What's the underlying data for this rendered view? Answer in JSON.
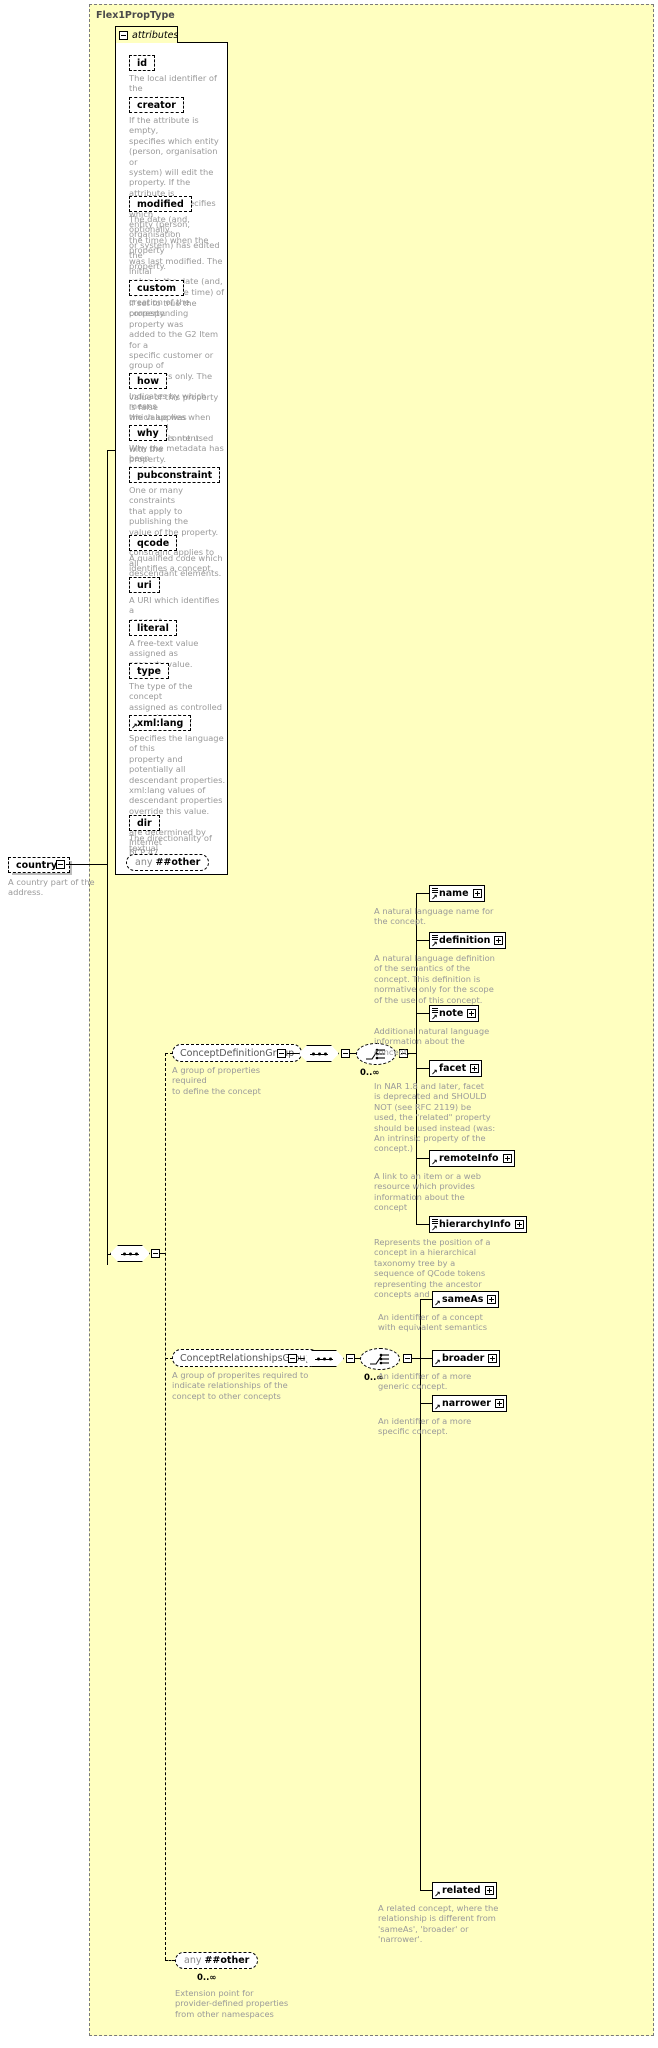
{
  "diagram": {
    "type_name": "Flex1PropType",
    "attributes_tab_label": "attributes",
    "attributes": [
      {
        "name": "id",
        "desc": "The local identifier of the\nproperty."
      },
      {
        "name": "creator",
        "desc": "If the attribute is empty,\nspecifies which entity\n(person, organisation or\nsystem) will edit the\nproperty. If the attribute is\nnon-empty, specifies which\nentity (person, organisation\nor system) has edited the\nproperty."
      },
      {
        "name": "modified",
        "desc": "The date (and, optionally,\nthe time) when the property\nwas last modified. The initial\nvalue is the date (and,\noptionally, the time) of\ncreation of the property."
      },
      {
        "name": "custom",
        "desc": "If set to true the\ncorresponding property was\nadded to the G2 Item for a\nspecific customer or group of\ncustomers only. The default\nvalue of this property is false\nwhich applies when this\nattribute is not used with the\nproperty."
      },
      {
        "name": "how",
        "desc": "Indicates by which means\nthe value was extracted\nfrom the content."
      },
      {
        "name": "why",
        "desc": "Why the metadata has been\nincluded."
      },
      {
        "name": "pubconstraint",
        "desc": "One or many constraints\nthat apply to publishing the\nvalue of the property. Each\nconstraint applies to all\ndescendant elements."
      },
      {
        "name": "qcode",
        "desc": "A qualified code which\nidentifies a concept."
      },
      {
        "name": "uri",
        "desc": "A URI which identifies a\nconcept."
      },
      {
        "name": "literal",
        "desc": "A free-text value assigned as\nproperty value."
      },
      {
        "name": "type",
        "desc": "The type of the concept\nassigned as controlled\nproperty value."
      },
      {
        "name": "xml:lang",
        "desc": "Specifies the language of this\nproperty and potentially all\ndescendant properties.\nxml:lang values of\ndescendant properties\noverride this value. Values\nare determined by Internet\nBCP 47."
      },
      {
        "name": "dir",
        "desc": "The directionality of textual\ncontent."
      }
    ],
    "attributes_any": {
      "prefix": "any",
      "label": "##other"
    },
    "root_element": {
      "name": "country",
      "desc": "A country part of the\naddress."
    },
    "groups": [
      {
        "name": "ConceptDefinitionGroup",
        "desc": "A group of properties required\nto define the concept",
        "cardinality": "0..∞",
        "elements": [
          {
            "name": "name",
            "desc": "A natural language name for\nthe concept.",
            "has_stripes": true
          },
          {
            "name": "definition",
            "desc": "A natural language definition\nof the semantics of the\nconcept. This definition is\nnormative only for the scope\nof the use of this concept.",
            "has_stripes": true
          },
          {
            "name": "note",
            "desc": "Additional natural language\ninformation about the\nconcept.",
            "has_stripes": true
          },
          {
            "name": "facet",
            "desc": "In NAR 1.8 and later, facet\nis deprecated and SHOULD\nNOT (see RFC 2119) be\nused, the \"related\" property\nshould be used instead (was:\nAn intrinsic property of the\nconcept.)",
            "has_stripes": false
          },
          {
            "name": "remoteInfo",
            "desc": "A link to an item or a web\nresource which provides\ninformation about the\nconcept",
            "has_stripes": false
          },
          {
            "name": "hierarchyInfo",
            "desc": "Represents the position of a\nconcept in a hierarchical\ntaxonomy tree by a\nsequence of QCode tokens\nrepresenting the ancestor\nconcepts and this concept",
            "has_stripes": true
          }
        ]
      },
      {
        "name": "ConceptRelationshipsGroup",
        "desc": "A group of properites required to\nindicate relationships of the\nconcept to other concepts",
        "cardinality": "0..∞",
        "elements": [
          {
            "name": "sameAs",
            "desc": "An identifier of a concept\nwith equivalent semantics",
            "has_stripes": false
          },
          {
            "name": "broader",
            "desc": "An identifier of a more\ngeneric concept.",
            "has_stripes": false
          },
          {
            "name": "narrower",
            "desc": "An identifier of a more\nspecific concept.",
            "has_stripes": false
          },
          {
            "name": "related",
            "desc": "A related concept, where the\nrelationship is different from\n'sameAs', 'broader' or\n'narrower'.",
            "has_stripes": false
          }
        ]
      }
    ],
    "extension_any": {
      "prefix": "any",
      "label": "##other",
      "cardinality": "0..∞",
      "desc": "Extension point for\nprovider-defined properties\nfrom other namespaces"
    },
    "colors": {
      "type_background": "#ffffc0",
      "description_text": "#9a9a9a",
      "border": "#000000",
      "shadow": "#bcbcbc"
    }
  }
}
